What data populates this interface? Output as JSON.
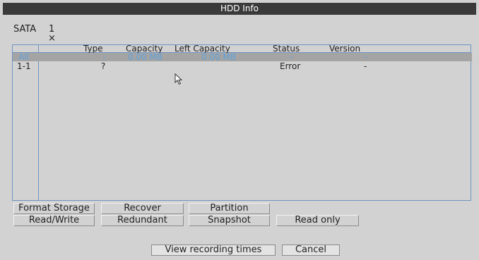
{
  "window": {
    "title": "HDD Info"
  },
  "disk": {
    "sata_label": "SATA",
    "sata_number": "1",
    "state_symbol": "×"
  },
  "table": {
    "columns": {
      "type": "Type",
      "capacity": "Capacity",
      "left_capacity": "Left Capacity",
      "status": "Status",
      "version": "Version"
    },
    "rows": [
      {
        "id": "All",
        "type": "-",
        "capacity": "0.00 MB",
        "left_capacity": "0.00 MB",
        "status": "-",
        "version": "-",
        "selected": true
      },
      {
        "id": "1-1",
        "type": "?",
        "capacity": "",
        "left_capacity": "",
        "status": "Error",
        "version": "-",
        "selected": false
      }
    ]
  },
  "buttons": {
    "format_storage": "Format Storage",
    "recover": "Recover",
    "partition": "Partition",
    "read_write": "Read/Write",
    "redundant": "Redundant",
    "snapshot": "Snapshot",
    "read_only": "Read only",
    "view_recording_times": "View recording times",
    "cancel": "Cancel"
  },
  "colors": {
    "title_bar": "#3a3a3a",
    "background": "#d2d2d2",
    "table_border": "#6f95c3",
    "selected_row": "#a4a4a4",
    "selected_text": "#5ea2dd"
  },
  "icons": {
    "cursor": "mouse-pointer-icon"
  }
}
